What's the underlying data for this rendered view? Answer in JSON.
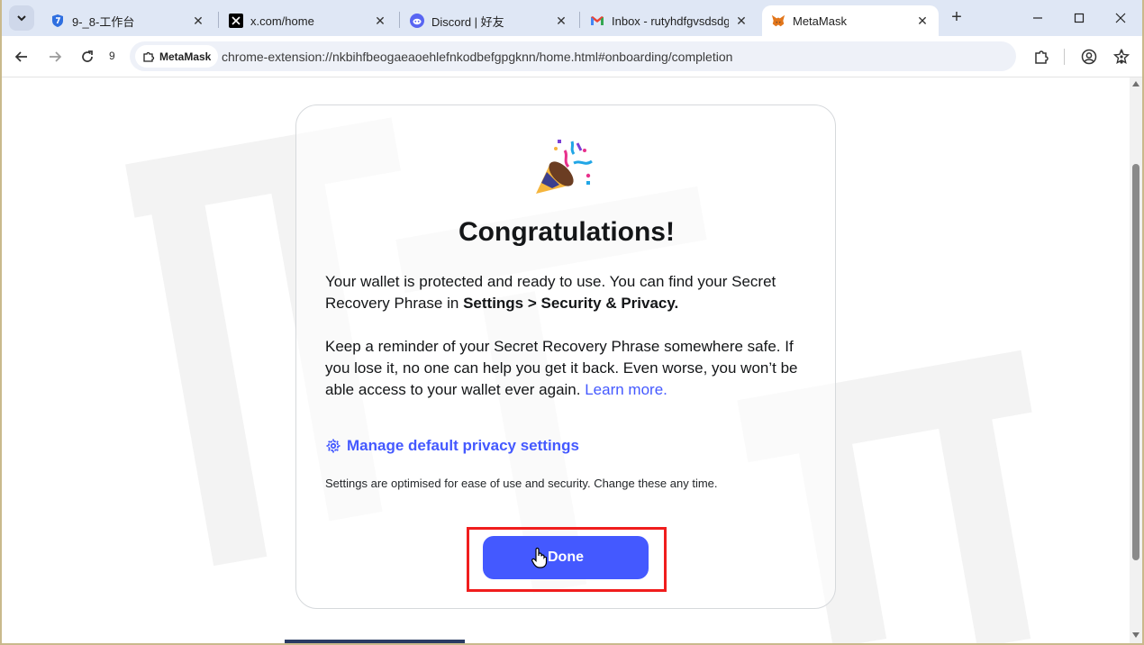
{
  "browser": {
    "tabs": [
      {
        "title": "9-_8-工作台",
        "icon": "shield-icon",
        "active": false
      },
      {
        "title": "x.com/home",
        "icon": "x-logo-icon",
        "active": false
      },
      {
        "title": "Discord | 好友",
        "icon": "discord-icon",
        "active": false
      },
      {
        "title": "Inbox - rutyhdfgvsdsdgd",
        "icon": "gmail-icon",
        "active": false
      },
      {
        "title": "MetaMask",
        "icon": "metamask-fox-icon",
        "active": true
      }
    ],
    "reload_count": "9",
    "site_chip": "MetaMask",
    "url": "chrome-extension://nkbihfbeogaeaoehlefnkodbefgpgknn/home.html#onboarding/completion"
  },
  "page": {
    "heading": "Congratulations!",
    "para1_text": "Your wallet is protected and ready to use. You can find your Secret Recovery Phrase in ",
    "para1_bold": "Settings > Security & Privacy.",
    "para2_text": "Keep a reminder of your Secret Recovery Phrase somewhere safe. If you lose it, no one can help you get it back. Even worse, you won’t be able access to your wallet ever again. ",
    "para2_link": "Learn more.",
    "manage_link": "Manage default privacy settings",
    "note": "Settings are optimised for ease of use and security. Change these any time.",
    "done_label": "Done"
  },
  "colors": {
    "primary": "#4459ff",
    "highlight": "#f01d1d",
    "text": "#141618"
  }
}
